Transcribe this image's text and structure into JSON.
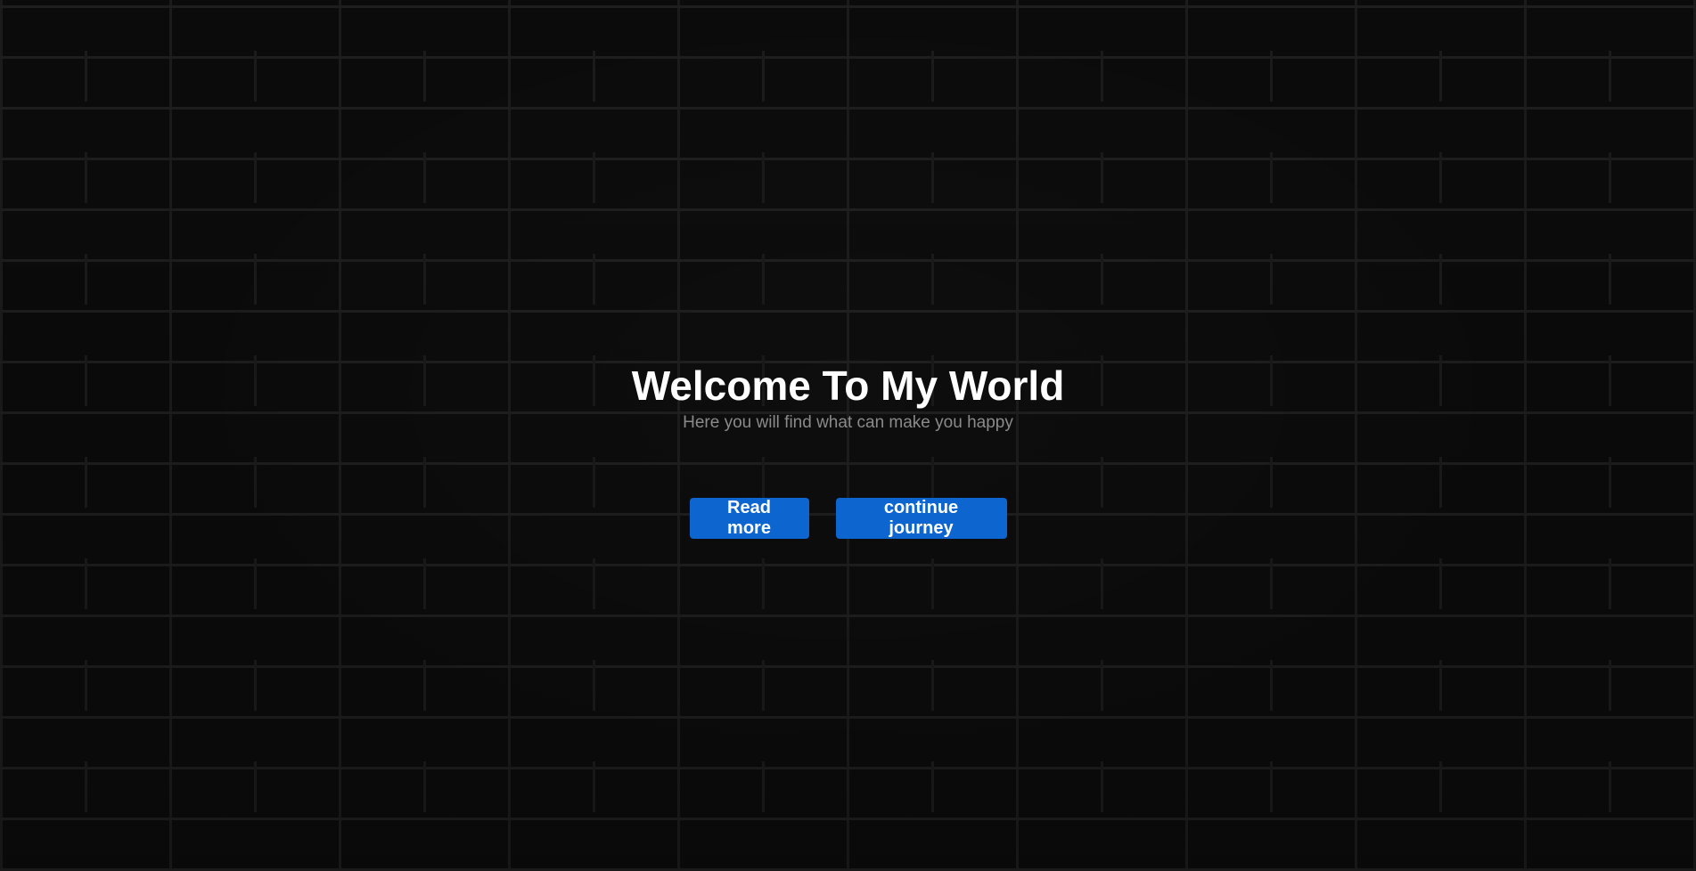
{
  "hero": {
    "title": "Welcome To My World",
    "subtitle": "Here you will find what can make you happy",
    "background": "brick-wall-dark"
  },
  "actions": {
    "read_more_label": "Read more",
    "continue_label": "continue journey"
  },
  "colors": {
    "button_bg": "#0d66d0",
    "title": "#ffffff",
    "subtitle": "#8a8a8a",
    "background": "#0b0b0b"
  }
}
